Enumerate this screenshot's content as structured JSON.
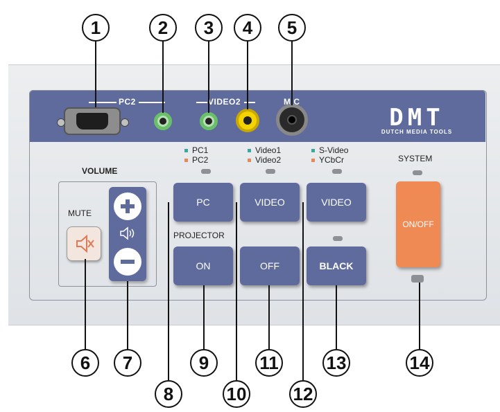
{
  "callouts": [
    "1",
    "2",
    "3",
    "4",
    "5",
    "6",
    "7",
    "8",
    "9",
    "10",
    "11",
    "12",
    "13",
    "14"
  ],
  "strip_labels": {
    "pc2": "PC2",
    "video2": "VIDEO2",
    "mic": "MIC"
  },
  "logo": {
    "text": "DMT",
    "subtitle": "DUTCH MEDIA TOOLS"
  },
  "source_labels": {
    "pc1": "PC1",
    "pc2": "PC2",
    "video1": "Video1",
    "video2": "Video2",
    "svideo": "S-Video",
    "ycbcr": "YCbCr"
  },
  "section_labels": {
    "volume": "VOLUME",
    "mute": "MUTE",
    "projector": "PROJECTOR",
    "system": "SYSTEM"
  },
  "buttons": {
    "pc": "PC",
    "video_a": "VIDEO",
    "video_b": "VIDEO",
    "on": "ON",
    "off": "OFF",
    "black": "BLACK",
    "onoff": "ON/OFF"
  },
  "colors": {
    "panel_blue": "#5f6b9c",
    "system_orange": "#f08a55",
    "dot_teal": "#3aa89a",
    "dot_orange": "#e8875a"
  },
  "icons": [
    "vga-port-icon",
    "audio-jack-icon",
    "rca-jack-icon",
    "mic-jack-icon",
    "speaker-mute-icon",
    "plus-icon",
    "minus-icon",
    "speaker-icon"
  ]
}
